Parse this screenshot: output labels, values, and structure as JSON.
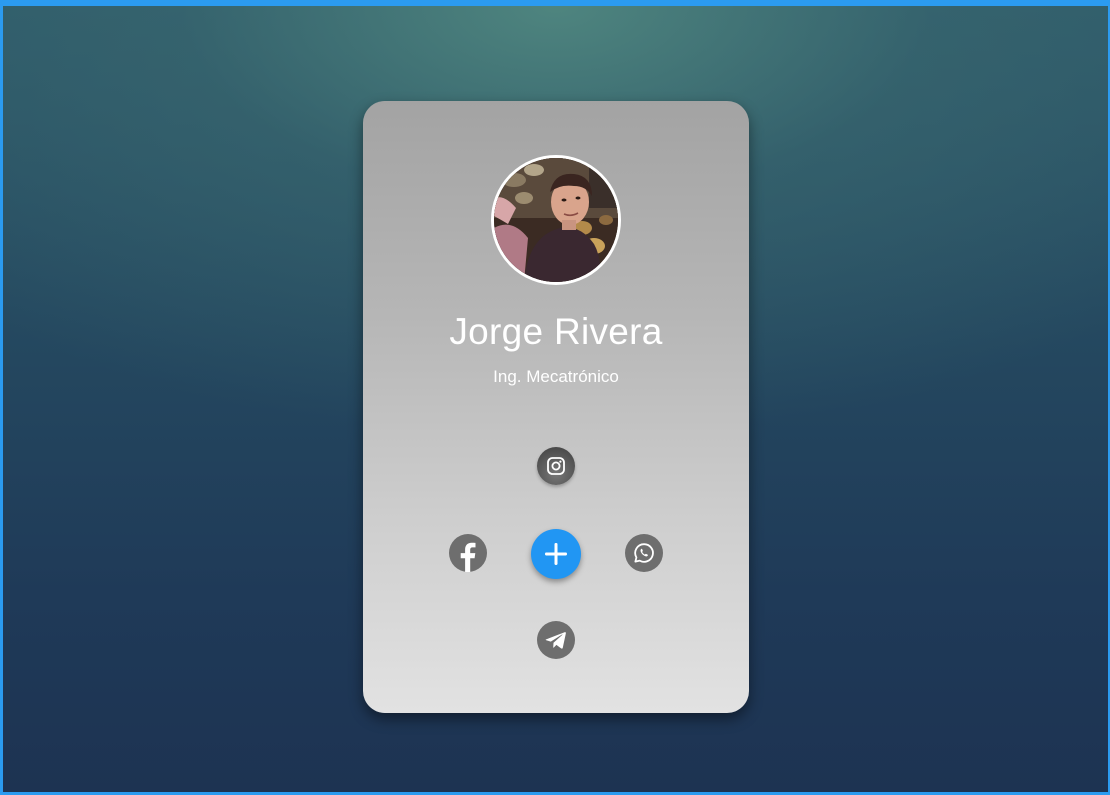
{
  "profile": {
    "name": "Jorge Rivera",
    "role": "Ing. Mecatrónico"
  },
  "social_links": [
    {
      "network": "instagram",
      "icon": "instagram-icon"
    },
    {
      "network": "facebook",
      "icon": "facebook-icon"
    },
    {
      "network": "whatsapp",
      "icon": "whatsapp-icon"
    },
    {
      "network": "telegram",
      "icon": "telegram-icon"
    }
  ],
  "toggle": {
    "icon": "plus-icon",
    "color": "#2196f3"
  },
  "colors": {
    "accent": "#2196f3",
    "social_icon_bg": "#6e6e6e",
    "frame_border": "#2b9bf0"
  }
}
